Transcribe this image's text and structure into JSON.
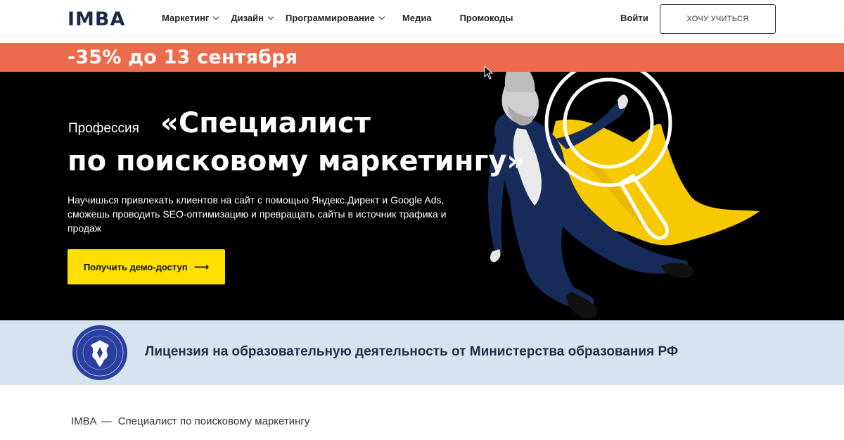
{
  "header": {
    "logo": "IMBA",
    "nav": [
      {
        "label": "Маркетинг",
        "dropdown": true
      },
      {
        "label": "Дизайн",
        "dropdown": true
      },
      {
        "label": "Программирование",
        "dropdown": true
      },
      {
        "label": "Медиа",
        "dropdown": false
      },
      {
        "label": "Промокоды",
        "dropdown": false
      }
    ],
    "login": "Войти",
    "cta": "ХОЧУ УЧИТЬСЯ"
  },
  "promo": {
    "text": "-35% до 13 сентября",
    "color": "#ec6b4c"
  },
  "hero": {
    "label": "Профессия",
    "title_line1": "«Специалист",
    "title_line2": "по поисковому маркетингу»",
    "description": "Научишься привлекать клиентов на сайт с помощью Яндекс.Директ и Google Ads, сможешь проводить SEO-оптимизацию и превращать сайты в источник трафика и продаж",
    "button": "Получить демо-доступ",
    "button_icon": "arrow-right-icon",
    "button_color": "#ffe000",
    "background": "#000000"
  },
  "license": {
    "text": "Лицензия на образовательную деятельность от Министерства образования РФ",
    "icon": "ministry-seal-icon",
    "background": "#d6e4ef"
  },
  "breadcrumb": {
    "items": [
      "IMBA",
      "Специалист по поисковому маркетингу"
    ],
    "separator": "—"
  }
}
